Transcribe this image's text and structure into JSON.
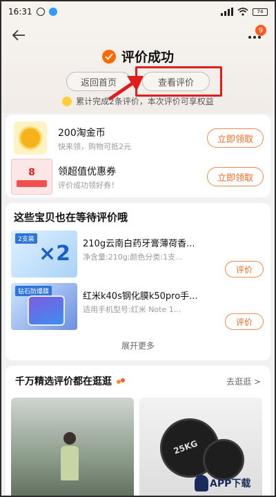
{
  "status_bar": {
    "time": "16:31",
    "battery": "74"
  },
  "header": {
    "more_badge": "9",
    "title": "评价成功",
    "return_label": "返回首页",
    "view_label": "查看评价",
    "reward_note": "累计完成2条评价，本次评价可享权益"
  },
  "rewards": [
    {
      "name": "200淘金币",
      "desc": "快来领，购物可抵2元",
      "button": "立即领取"
    },
    {
      "name": "领超值优惠券",
      "desc": "评价成功领好券！",
      "button": "立即领取",
      "coupon_value": "8"
    }
  ],
  "pending": {
    "title": "这些宝贝也在等待评价哦",
    "items": [
      {
        "name": "210g云南白药牙膏薄荷香...",
        "spec": "净含量:210g;颜色分类:1支...",
        "button": "评价",
        "thumb_tag": "2支装",
        "thumb_big": "×2"
      },
      {
        "name": "红米k40s钢化膜k50pro手...",
        "spec": "适用手机型号:红米 Note 1...",
        "button": "评价",
        "thumb_tag": "钻石防爆膜"
      }
    ],
    "expand_label": "展开更多"
  },
  "browse": {
    "title": "千万精选评价都在逛逛",
    "link": "去逛逛 >",
    "dumbbell_text": "25KG"
  },
  "watermark": {
    "text": "APP下载"
  },
  "colors": {
    "accent": "#f06a20",
    "highlight": "#e21b1b",
    "badge": "#ff5a1f"
  }
}
